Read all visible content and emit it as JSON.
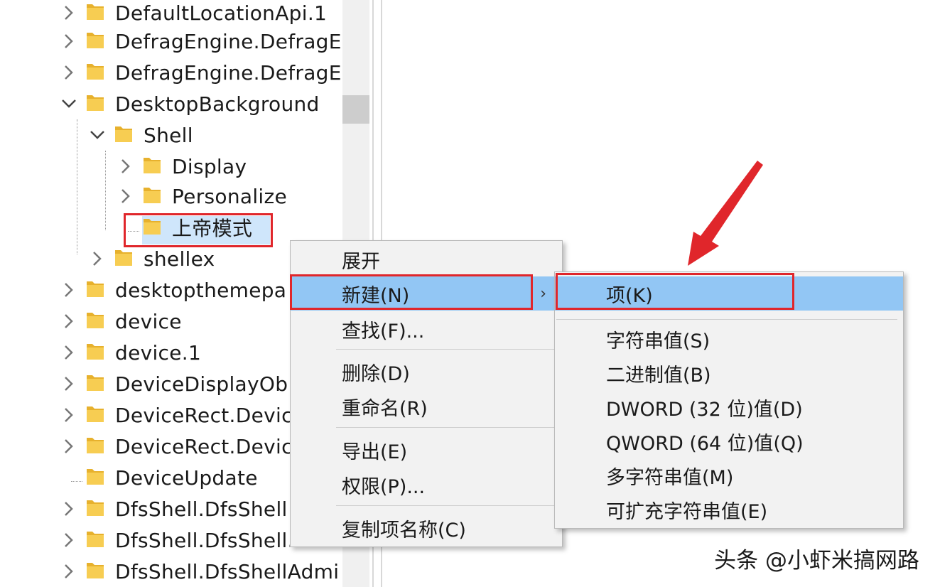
{
  "tree": {
    "items": [
      {
        "label": "DefaultLocationApi.1",
        "expanded": false
      },
      {
        "label": "DefragEngine.DefragE",
        "expanded": false
      },
      {
        "label": "DefragEngine.DefragE",
        "expanded": false
      },
      {
        "label": "DesktopBackground",
        "expanded": true
      },
      {
        "label": "Shell",
        "expanded": true
      },
      {
        "label": "Display",
        "expanded": false
      },
      {
        "label": "Personalize",
        "expanded": false
      },
      {
        "label": "上帝模式",
        "expanded": false,
        "selected": true
      },
      {
        "label": "shellex",
        "expanded": false
      },
      {
        "label": "desktopthemepa",
        "expanded": false
      },
      {
        "label": "device",
        "expanded": false
      },
      {
        "label": "device.1",
        "expanded": false
      },
      {
        "label": "DeviceDisplayOb",
        "expanded": false
      },
      {
        "label": "DeviceRect.Devic",
        "expanded": false
      },
      {
        "label": "DeviceRect.Devic",
        "expanded": false
      },
      {
        "label": "DeviceUpdate",
        "expanded": false
      },
      {
        "label": "DfsShell.DfsShell",
        "expanded": false
      },
      {
        "label": "DfsShell.DfsShell.",
        "expanded": false
      },
      {
        "label": "DfsShell.DfsShellAdmi",
        "expanded": false
      }
    ]
  },
  "context_menu": {
    "items": [
      {
        "label": "展开"
      },
      {
        "label": "新建(N)",
        "highlighted": true,
        "has_submenu": true
      },
      {
        "label": "查找(F)..."
      },
      {
        "label": "删除(D)"
      },
      {
        "label": "重命名(R)"
      },
      {
        "label": "导出(E)"
      },
      {
        "label": "权限(P)..."
      },
      {
        "label": "复制项名称(C)"
      }
    ],
    "submenu_arrow": "›"
  },
  "submenu": {
    "items": [
      {
        "label": "项(K)",
        "highlighted": true
      },
      {
        "label": "字符串值(S)"
      },
      {
        "label": "二进制值(B)"
      },
      {
        "label": "DWORD (32 位)值(D)"
      },
      {
        "label": "QWORD (64 位)值(Q)"
      },
      {
        "label": "多字符串值(M)"
      },
      {
        "label": "可扩充字符串值(E)"
      }
    ]
  },
  "watermark": "头条 @小虾米搞网路",
  "colors": {
    "highlight": "#92c6f4",
    "annotation_red": "#e0262b",
    "folder": "#f5c342"
  }
}
